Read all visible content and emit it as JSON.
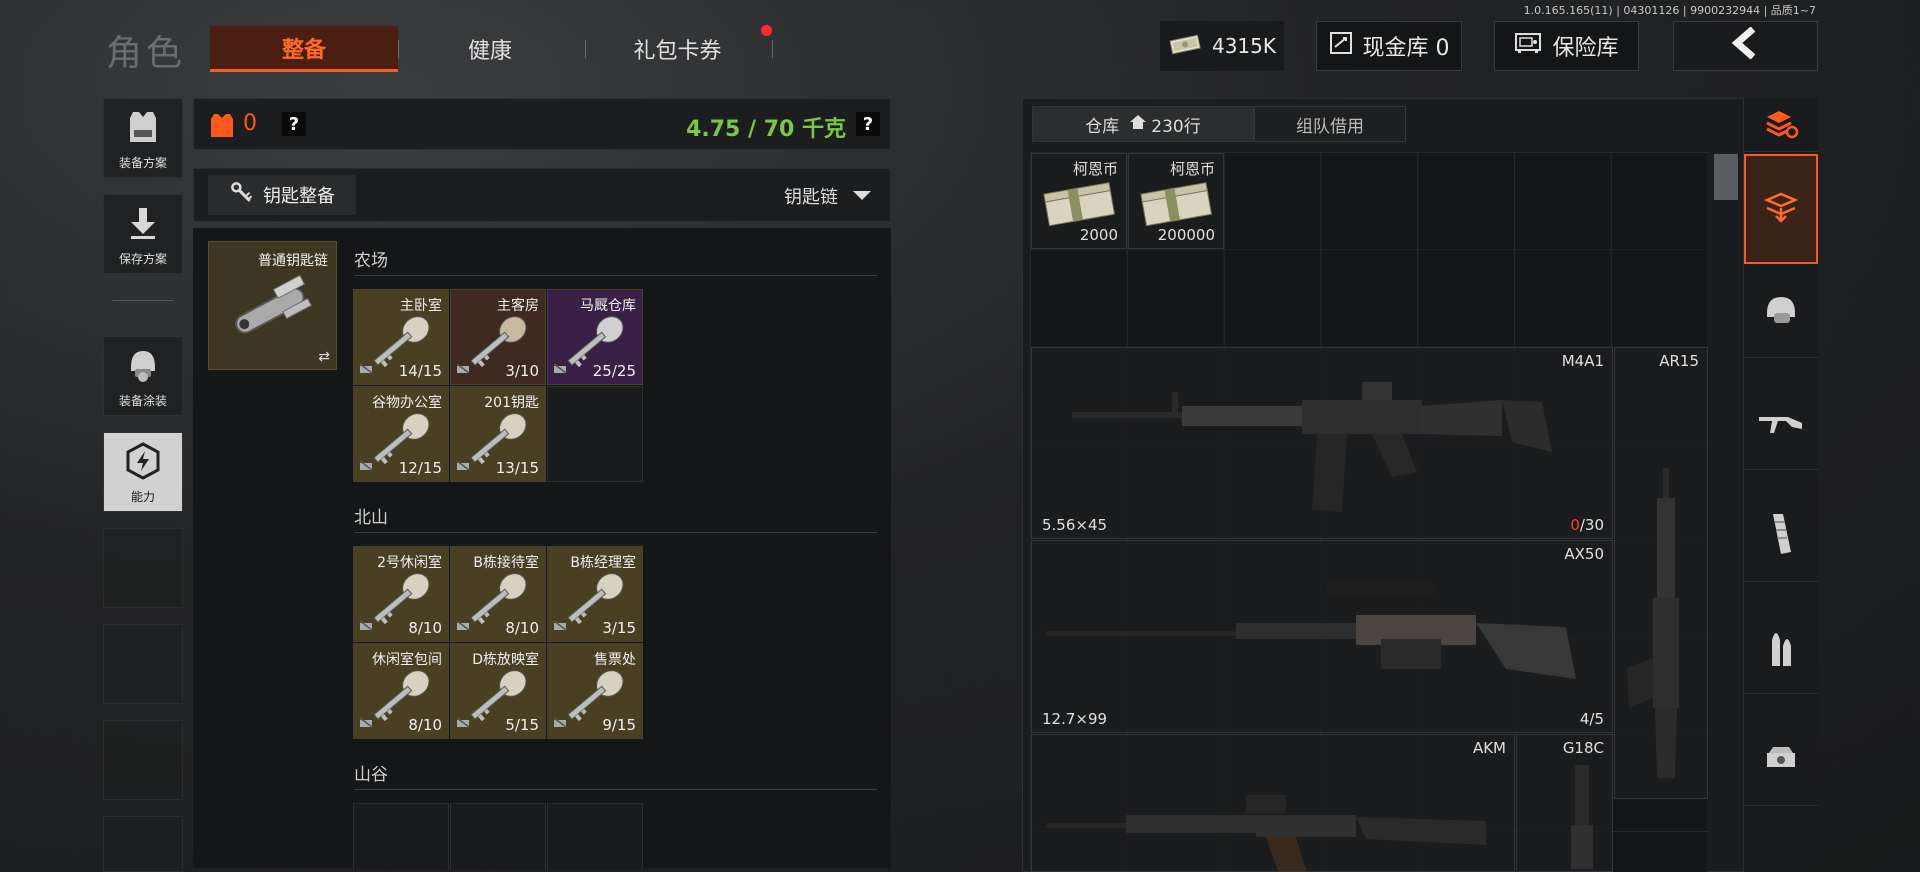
{
  "version": "1.0.165.165(11) | 04301126 | 9900232944 | 品质1~7",
  "header": {
    "title": "角色",
    "tabs": [
      {
        "label": "整备",
        "active": true
      },
      {
        "label": "健康",
        "active": false
      },
      {
        "label": "礼包卡券",
        "active": false,
        "badge": true
      }
    ],
    "money": "4315K",
    "cash_vault": "现金库 0",
    "safe_vault": "保险库"
  },
  "rail": {
    "items": [
      {
        "label": "装备方案",
        "icon": "vest-icon"
      },
      {
        "label": "保存方案",
        "icon": "download-icon"
      },
      {
        "label": "装备涂装",
        "icon": "helmet-icon"
      },
      {
        "label": "能力",
        "icon": "power-hex-icon"
      }
    ]
  },
  "loadout": {
    "armor_count": "0",
    "weight": "4.75 / 70 千克",
    "help": "?"
  },
  "keys": {
    "organize_label": "钥匙整备",
    "keychain_label": "钥匙链",
    "ring_label": "普通钥匙链",
    "sections": [
      {
        "title": "农场",
        "keys": [
          {
            "name": "主卧室",
            "count": "14/15",
            "tint": "gold"
          },
          {
            "name": "主客房",
            "count": "3/10",
            "tint": "brown"
          },
          {
            "name": "马厩仓库",
            "count": "25/25",
            "tint": "purple"
          },
          {
            "name": "谷物办公室",
            "count": "12/15",
            "tint": "gold"
          },
          {
            "name": "201钥匙",
            "count": "13/15",
            "tint": "gold"
          },
          {
            "name": "",
            "count": "",
            "tint": "empty"
          }
        ]
      },
      {
        "title": "北山",
        "keys": [
          {
            "name": "2号休闲室",
            "count": "8/10",
            "tint": "gold"
          },
          {
            "name": "B栋接待室",
            "count": "8/10",
            "tint": "gold"
          },
          {
            "name": "B栋经理室",
            "count": "3/15",
            "tint": "gold"
          },
          {
            "name": "休闲室包间",
            "count": "8/10",
            "tint": "gold"
          },
          {
            "name": "D栋放映室",
            "count": "5/15",
            "tint": "gold"
          },
          {
            "name": "售票处",
            "count": "9/15",
            "tint": "gold"
          }
        ]
      },
      {
        "title": "山谷",
        "keys": []
      }
    ]
  },
  "warehouse": {
    "tab_label": "仓库",
    "rows": "230行",
    "team_tab": "组队借用",
    "currency": [
      {
        "name": "柯恩币",
        "amount": "2000"
      },
      {
        "name": "柯恩币",
        "amount": "200000"
      }
    ],
    "weapons": [
      {
        "name": "M4A1",
        "caliber": "5.56×45",
        "ammo_loaded": "0",
        "ammo_cap": "/30"
      },
      {
        "name": "AR15"
      },
      {
        "name": "AX50",
        "caliber": "12.7×99",
        "ammo": "4/5"
      },
      {
        "name": "AKM"
      },
      {
        "name": "G18C"
      }
    ]
  },
  "categories": [
    "all-refresh-icon",
    "backpack-icon",
    "helmet-icon",
    "rifle-icon",
    "magazine-icon",
    "ammo-icon",
    "scope-icon"
  ],
  "colors": {
    "accent": "#ff5a1a",
    "weight_green": "#7ac840",
    "key_gold": "#4a3f22",
    "key_purple": "#3a1f46",
    "alert_red": "#ff3a3a"
  }
}
